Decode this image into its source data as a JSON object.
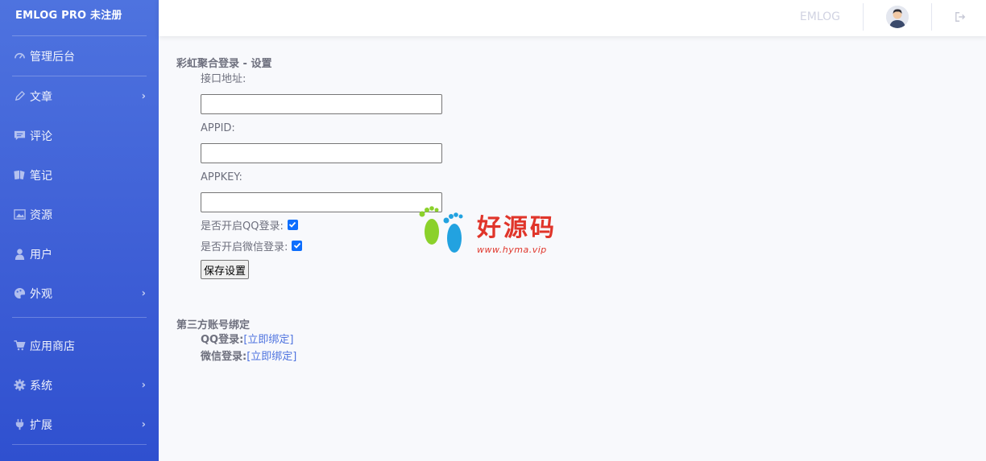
{
  "sidebar": {
    "brand": "EMLOG PRO 未注册",
    "items": [
      {
        "label": "管理后台",
        "icon": "dashboard-icon",
        "has_submenu": false
      },
      {
        "label": "文章",
        "icon": "pencil-icon",
        "has_submenu": true
      },
      {
        "label": "评论",
        "icon": "comment-icon",
        "has_submenu": false
      },
      {
        "label": "笔记",
        "icon": "notes-icon",
        "has_submenu": false
      },
      {
        "label": "资源",
        "icon": "image-icon",
        "has_submenu": false
      },
      {
        "label": "用户",
        "icon": "user-icon",
        "has_submenu": false
      },
      {
        "label": "外观",
        "icon": "palette-icon",
        "has_submenu": true
      },
      {
        "label": "应用商店",
        "icon": "cart-icon",
        "has_submenu": false
      },
      {
        "label": "系统",
        "icon": "gear-icon",
        "has_submenu": true
      },
      {
        "label": "扩展",
        "icon": "plug-icon",
        "has_submenu": true
      }
    ]
  },
  "topbar": {
    "site_name": "EMLOG"
  },
  "settings": {
    "title": "彩虹聚合登录 - 设置",
    "api_url_label": "接口地址:",
    "api_url_value": "",
    "appid_label": "APPID:",
    "appid_value": "",
    "appkey_label": "APPKEY:",
    "appkey_value": "",
    "qq_login_label": "是否开启QQ登录:",
    "qq_login_checked": true,
    "wechat_login_label": "是否开启微信登录:",
    "wechat_login_checked": true,
    "save_label": "保存设置"
  },
  "binding": {
    "title": "第三方账号绑定",
    "qq_label": "QQ登录:",
    "qq_link": "[立即绑定]",
    "wechat_label": "微信登录:",
    "wechat_link": "[立即绑定]"
  },
  "watermark": {
    "text": "好源码",
    "url": "www.hyma.vip"
  },
  "colors": {
    "sidebar": "#4e73df",
    "checkbox": "#0d6efd",
    "link": "#4e73df"
  }
}
